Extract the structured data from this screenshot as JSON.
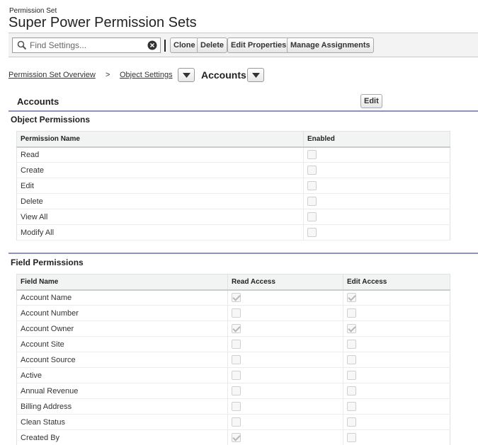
{
  "header": {
    "eyebrow": "Permission Set",
    "title": "Super Power Permission Sets"
  },
  "toolbar": {
    "search_placeholder": "Find Settings...",
    "buttons": [
      "Clone",
      "Delete",
      "Edit Properties",
      "Manage Assignments"
    ]
  },
  "breadcrumb": {
    "overview_link": "Permission Set Overview",
    "separator": ">",
    "object_settings_link": "Object Settings",
    "current": "Accounts"
  },
  "section": {
    "title": "Accounts",
    "edit_label": "Edit"
  },
  "object_permissions": {
    "title": "Object Permissions",
    "columns": [
      "Permission Name",
      "Enabled"
    ],
    "rows": [
      {
        "name": "Read",
        "enabled": false
      },
      {
        "name": "Create",
        "enabled": false
      },
      {
        "name": "Edit",
        "enabled": false
      },
      {
        "name": "Delete",
        "enabled": false
      },
      {
        "name": "View All",
        "enabled": false
      },
      {
        "name": "Modify All",
        "enabled": false
      }
    ]
  },
  "field_permissions": {
    "title": "Field Permissions",
    "columns": [
      "Field Name",
      "Read Access",
      "Edit Access"
    ],
    "rows": [
      {
        "name": "Account Name",
        "read": true,
        "edit": true
      },
      {
        "name": "Account Number",
        "read": false,
        "edit": false
      },
      {
        "name": "Account Owner",
        "read": true,
        "edit": true
      },
      {
        "name": "Account Site",
        "read": false,
        "edit": false
      },
      {
        "name": "Account Source",
        "read": false,
        "edit": false
      },
      {
        "name": "Active",
        "read": false,
        "edit": false
      },
      {
        "name": "Annual Revenue",
        "read": false,
        "edit": false
      },
      {
        "name": "Billing Address",
        "read": false,
        "edit": false
      },
      {
        "name": "Clean Status",
        "read": false,
        "edit": false
      },
      {
        "name": "Created By",
        "read": true,
        "edit": false
      }
    ]
  },
  "colors": {
    "section_rule": "#8a96b8",
    "toolbar_bg": "#f3f3f3",
    "header_bg": "#f2f3f3"
  }
}
